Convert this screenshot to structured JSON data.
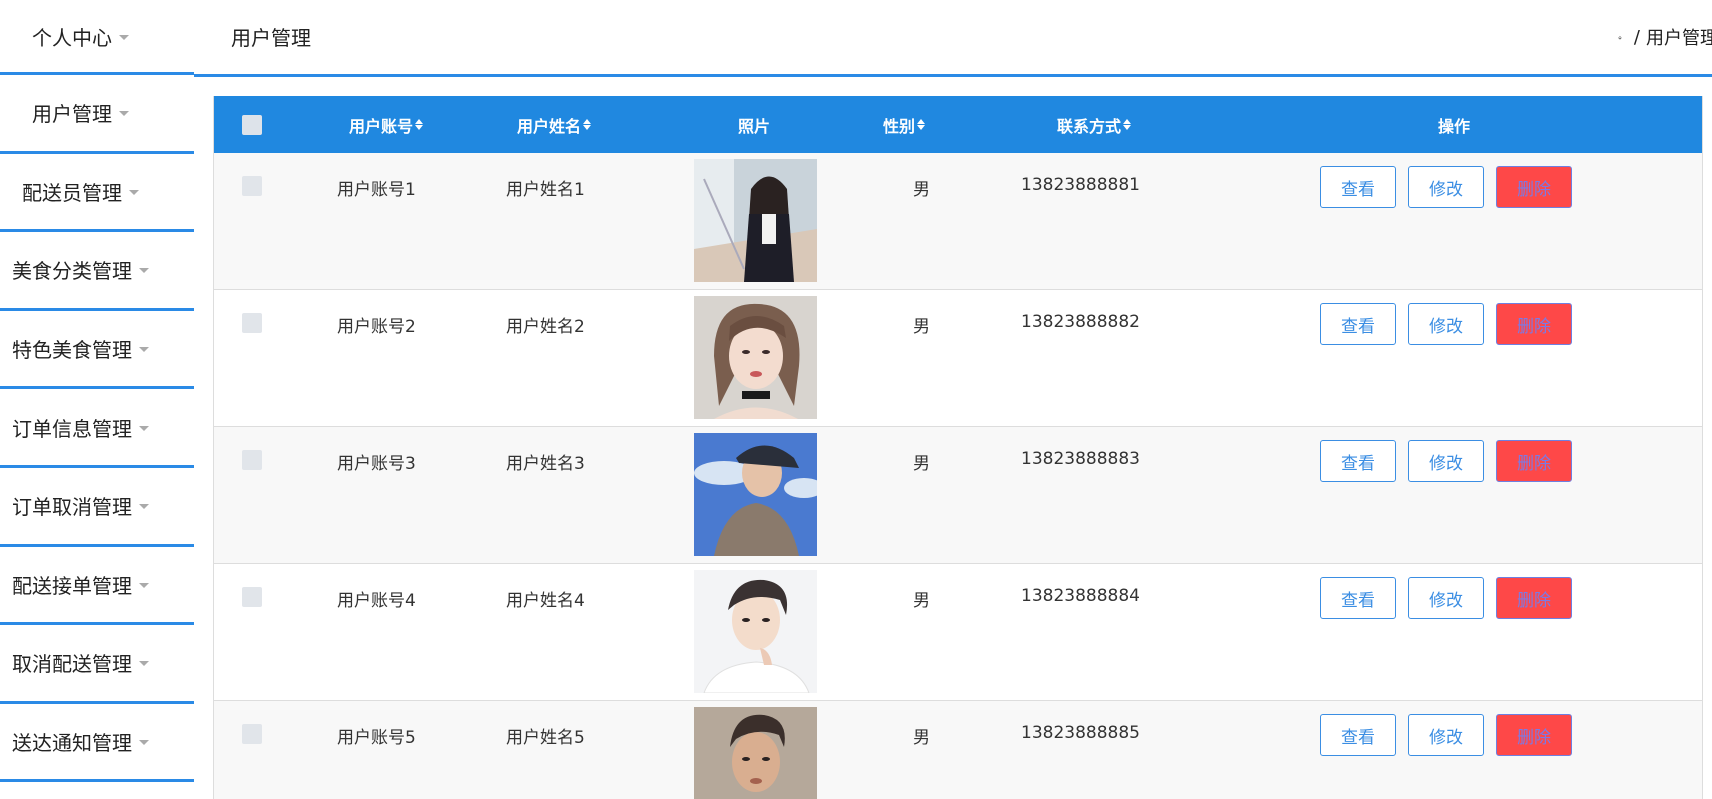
{
  "sidebar": {
    "items": [
      {
        "label": "个人中心"
      },
      {
        "label": "用户管理"
      },
      {
        "label": "配送员管理"
      },
      {
        "label": "美食分类管理"
      },
      {
        "label": "特色美食管理"
      },
      {
        "label": "订单信息管理"
      },
      {
        "label": "订单取消管理"
      },
      {
        "label": "配送接单管理"
      },
      {
        "label": "取消配送管理"
      },
      {
        "label": "送达通知管理"
      }
    ]
  },
  "header": {
    "title": "用户管理",
    "breadcrumb": [
      "用户管理"
    ]
  },
  "table": {
    "columns": {
      "account": "用户账号",
      "name": "用户姓名",
      "photo": "照片",
      "gender": "性别",
      "phone": "联系方式",
      "actions": "操作"
    },
    "rows": [
      {
        "account": "用户账号1",
        "name": "用户姓名1",
        "gender": "男",
        "phone": "13823888881"
      },
      {
        "account": "用户账号2",
        "name": "用户姓名2",
        "gender": "男",
        "phone": "13823888882"
      },
      {
        "account": "用户账号3",
        "name": "用户姓名3",
        "gender": "男",
        "phone": "13823888883"
      },
      {
        "account": "用户账号4",
        "name": "用户姓名4",
        "gender": "男",
        "phone": "13823888884"
      },
      {
        "account": "用户账号5",
        "name": "用户姓名5",
        "gender": "男",
        "phone": "13823888885"
      }
    ],
    "buttons": {
      "view": "查看",
      "edit": "修改",
      "delete": "删除"
    }
  },
  "colors": {
    "accent": "#2088e0",
    "delete": "#fe4848"
  }
}
